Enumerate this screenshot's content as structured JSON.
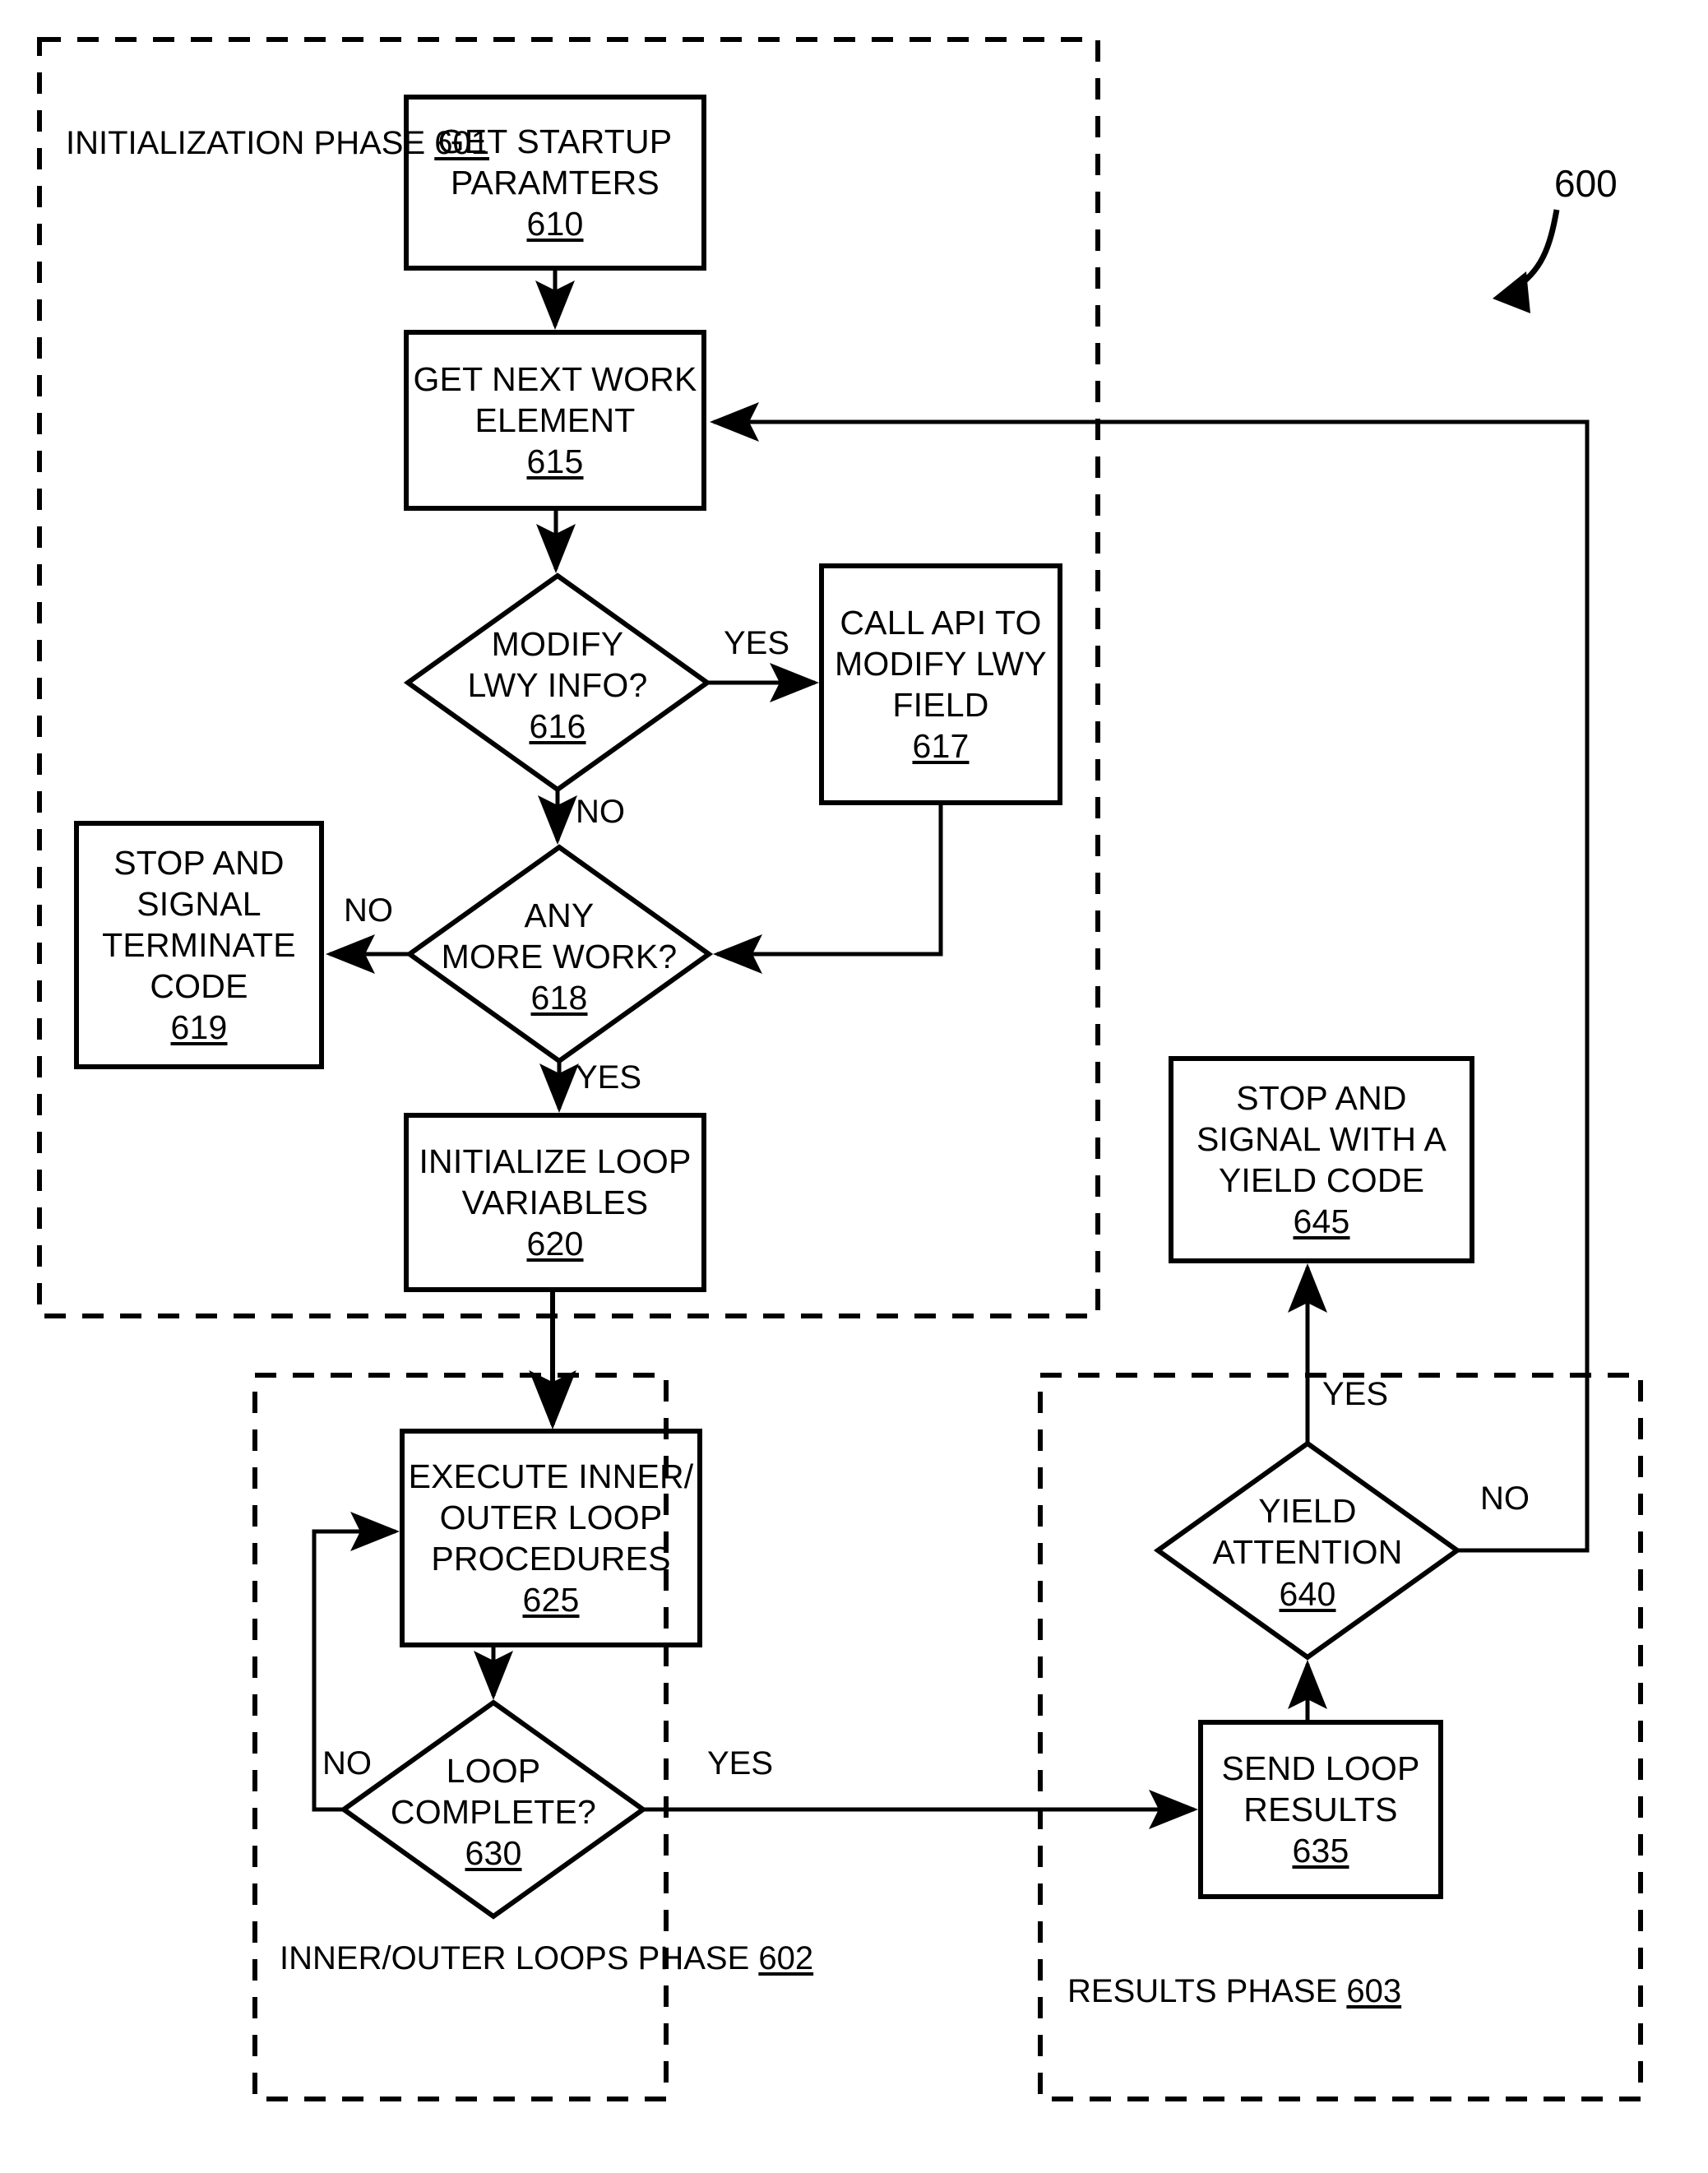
{
  "figure": {
    "reference_numeral": "600"
  },
  "phases": [
    {
      "id": "601",
      "name": "initialization-phase",
      "lines": [
        "INITIALIZATION",
        "PHASE"
      ],
      "ref": "601"
    },
    {
      "id": "602",
      "name": "inner-outer-loops-phase",
      "lines": [
        "INNER/OUTER",
        "LOOPS PHASE"
      ],
      "ref": "602"
    },
    {
      "id": "603",
      "name": "results-phase",
      "lines": [
        "RESULTS PHASE"
      ],
      "ref": "603"
    }
  ],
  "nodes": [
    {
      "id": "610",
      "shape": "process",
      "lines": [
        "GET STARTUP",
        "PARAMTERS"
      ],
      "ref": "610"
    },
    {
      "id": "615",
      "shape": "process",
      "lines": [
        "GET NEXT WORK",
        "ELEMENT"
      ],
      "ref": "615"
    },
    {
      "id": "616",
      "shape": "decision",
      "lines": [
        "MODIFY",
        "LWY INFO?"
      ],
      "ref": "616"
    },
    {
      "id": "617",
      "shape": "process",
      "lines": [
        "CALL API TO",
        "MODIFY LWY",
        "FIELD"
      ],
      "ref": "617"
    },
    {
      "id": "618",
      "shape": "decision",
      "lines": [
        "ANY",
        "MORE WORK?"
      ],
      "ref": "618"
    },
    {
      "id": "619",
      "shape": "process",
      "lines": [
        "STOP AND",
        "SIGNAL",
        "TERMINATE",
        "CODE"
      ],
      "ref": "619"
    },
    {
      "id": "620",
      "shape": "process",
      "lines": [
        "INITIALIZE LOOP",
        "VARIABLES"
      ],
      "ref": "620"
    },
    {
      "id": "625",
      "shape": "process",
      "lines": [
        "EXECUTE INNER/",
        "OUTER LOOP",
        "PROCEDURES"
      ],
      "ref": "625"
    },
    {
      "id": "630",
      "shape": "decision",
      "lines": [
        "LOOP",
        "COMPLETE?"
      ],
      "ref": "630"
    },
    {
      "id": "635",
      "shape": "process",
      "lines": [
        "SEND LOOP",
        "RESULTS"
      ],
      "ref": "635"
    },
    {
      "id": "640",
      "shape": "decision",
      "lines": [
        "YIELD",
        "ATTENTION"
      ],
      "ref": "640"
    },
    {
      "id": "645",
      "shape": "process",
      "lines": [
        "STOP AND",
        "SIGNAL WITH A",
        "YIELD CODE"
      ],
      "ref": "645"
    }
  ],
  "edge_labels": [
    {
      "id": "616-yes",
      "text": "YES"
    },
    {
      "id": "616-no",
      "text": "NO"
    },
    {
      "id": "618-no",
      "text": "NO"
    },
    {
      "id": "618-yes",
      "text": "YES"
    },
    {
      "id": "630-no",
      "text": "NO"
    },
    {
      "id": "630-yes",
      "text": "YES"
    },
    {
      "id": "640-yes",
      "text": "YES"
    },
    {
      "id": "640-no",
      "text": "NO"
    }
  ],
  "colors": {
    "stroke": "#000000",
    "background": "#ffffff"
  }
}
